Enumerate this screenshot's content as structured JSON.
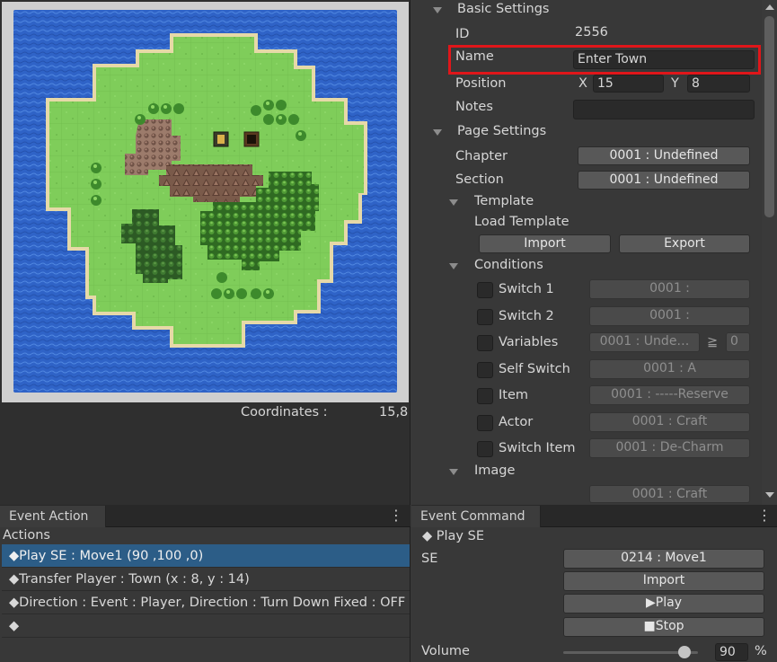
{
  "map": {
    "coordinates_label": "Coordinates :",
    "coordinates_value": "15,8"
  },
  "basic": {
    "title": "Basic Settings",
    "id_label": "ID",
    "id_value": "2556",
    "name_label": "Name",
    "name_value": "Enter Town",
    "position_label": "Position",
    "x_label": "X",
    "x_value": "15",
    "y_label": "Y",
    "y_value": "8",
    "notes_label": "Notes",
    "notes_value": ""
  },
  "page": {
    "title": "Page Settings",
    "chapter_label": "Chapter",
    "chapter_value": "0001 : Undefined",
    "section_label": "Section",
    "section_value": "0001 : Undefined",
    "template_title": "Template",
    "load_template_label": "Load Template",
    "import_label": "Import",
    "export_label": "Export",
    "conditions_title": "Conditions",
    "conditions": [
      {
        "label": "Switch 1",
        "value": "0001 :"
      },
      {
        "label": "Switch 2",
        "value": "0001 :"
      },
      {
        "label": "Variables",
        "value": "0001 : Unde…",
        "operator": "≧",
        "amount": "0"
      },
      {
        "label": "Self Switch",
        "value": "0001 : A"
      },
      {
        "label": "Item",
        "value": "0001 : -----Reserve"
      },
      {
        "label": "Actor",
        "value": "0001 : Craft"
      },
      {
        "label": "Switch Item",
        "value": "0001 : De-Charm"
      }
    ],
    "image_title": "Image",
    "image_value": "0001 : Craft"
  },
  "event_action": {
    "tab": "Event Action",
    "actions_label": "Actions",
    "items": [
      "◆Play SE : Move1 (90 ,100 ,0)",
      "◆Transfer Player : Town (x : 8, y : 14)",
      "◆Direction : Event : Player, Direction : Turn Down Fixed : OFF",
      "◆"
    ]
  },
  "event_command": {
    "tab": "Event Command",
    "title": "◆ Play SE",
    "se_label": "SE",
    "se_value": "0214 : Move1",
    "import_label": "Import",
    "play_label": "▶Play",
    "stop_label": "■Stop",
    "volume_label": "Volume",
    "volume_value": "90",
    "volume_unit": "%",
    "volume_fraction": 0.9
  },
  "colors": {
    "highlight": "#e0161a",
    "selected_row": "#2c5d87",
    "water": "#2f63c7",
    "grass": "#7fcd5a"
  },
  "icons": [
    "foldout-arrow-icon",
    "more-menu-icon",
    "scrollbar-up-icon",
    "scrollbar-down-icon",
    "checkbox-icon"
  ]
}
